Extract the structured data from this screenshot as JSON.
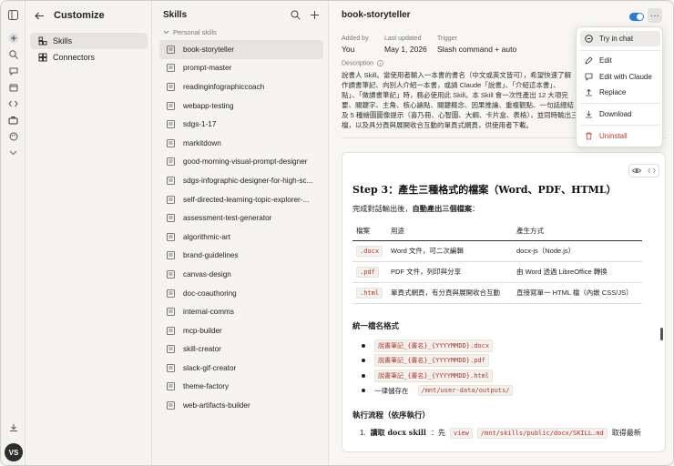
{
  "nav": {
    "title": "Customize",
    "items": [
      {
        "label": "Skills",
        "icon": "skills-icon"
      },
      {
        "label": "Connectors",
        "icon": "connectors-icon"
      }
    ]
  },
  "user": {
    "initials": "VS"
  },
  "skills_panel": {
    "title": "Skills",
    "section": "Personal skills",
    "items": [
      "book-storyteller",
      "prompt-master",
      "readinginfographiccoach",
      "webapp-testing",
      "sdgs-1-17",
      "markitdown",
      "good-morning-visual-prompt-designer",
      "sdgs-infographic-designer-for-high-sc...",
      "self-directed-learning-topic-explorer-...",
      "assessment-test-generator",
      "algorithmic-art",
      "brand-guidelines",
      "canvas-design",
      "doc-coauthoring",
      "internal-comms",
      "mcp-builder",
      "skill-creator",
      "slack-gif-creator",
      "theme-factory",
      "web-artifacts-builder"
    ]
  },
  "detail": {
    "title": "book-storyteller",
    "added_by_label": "Added by",
    "added_by": "You",
    "updated_label": "Last updated",
    "updated": "May 1, 2026",
    "trigger_label": "Trigger",
    "trigger": "Slash command + auto",
    "desc_label": "Description",
    "desc_lines": [
      "說書人 Skill。當使用者輸入一本書的書名（中文或英文皆可），希望快速了解",
      "作讀書筆記、向別人介紹一本書，或請 Claude「說書」、「介紹這本書」、",
      "點」、「做讀書筆記」時，務必使用此 Skill。本 Skill 會一次性產出 12 大項完",
      "要、關鍵字、主角、核心論點、關鍵概念、因果推論、重複觀點、一句話總結",
      "及 5 種繪圖圖像提示（喜乃冊、心智圖、大綱、卡片盒、表格），並同時輸出三",
      "檔，以及具分頁與展開收合互動的單頁式網頁，供使用者下載。"
    ]
  },
  "doc": {
    "heading": "Step 3：產生三種格式的檔案（Word、PDF、HTML）",
    "intro_prefix": "完成對話輸出後，",
    "intro_bold": "自動產出三個檔案",
    "intro_suffix": "：",
    "table_headers": [
      "檔案",
      "用途",
      "產生方式"
    ],
    "table_rows": [
      {
        "ext": ".docx",
        "use": "Word 文件，可二次編輯",
        "how": "docx-js（Node.js）"
      },
      {
        "ext": ".pdf",
        "use": "PDF 文件，列印與分享",
        "how": "由 Word 透過 LibreOffice 轉換"
      },
      {
        "ext": ".html",
        "use": "單頁式網頁，有分頁與展開收合互動",
        "how": "直接寫單一 HTML 檔（內嵌 CSS/JS）"
      }
    ],
    "naming_heading": "統一檔名格式",
    "naming_items": [
      "說書筆記_{書名}_{YYYYMMDD}.docx",
      "說書筆記_{書名}_{YYYYMMDD}.pdf",
      "說書筆記_{書名}_{YYYYMMDD}.html"
    ],
    "save_prefix": "一律儲存在",
    "save_path": "/mnt/user-data/outputs/",
    "flow_heading": "執行流程（依序執行）",
    "step1_num": "1.",
    "step1_bold": "讀取 docx skill",
    "step1_mid": "：先",
    "step1_code1": "view",
    "step1_code2": "/mnt/skills/public/docx/SKILL.md",
    "step1_tail": "取得最新"
  },
  "menu": {
    "items": [
      {
        "label": "Try in chat",
        "icon": "chat-icon"
      },
      {
        "label": "Edit",
        "icon": "pencil-icon"
      },
      {
        "label": "Edit with Claude",
        "icon": "claude-chat-icon"
      },
      {
        "label": "Replace",
        "icon": "upload-icon"
      },
      {
        "label": "Download",
        "icon": "download-icon"
      },
      {
        "label": "Uninstall",
        "icon": "trash-icon"
      }
    ]
  },
  "colors": {
    "accent": "#2f7bd7",
    "danger": "#c0392b",
    "code_text": "#b5372d"
  }
}
